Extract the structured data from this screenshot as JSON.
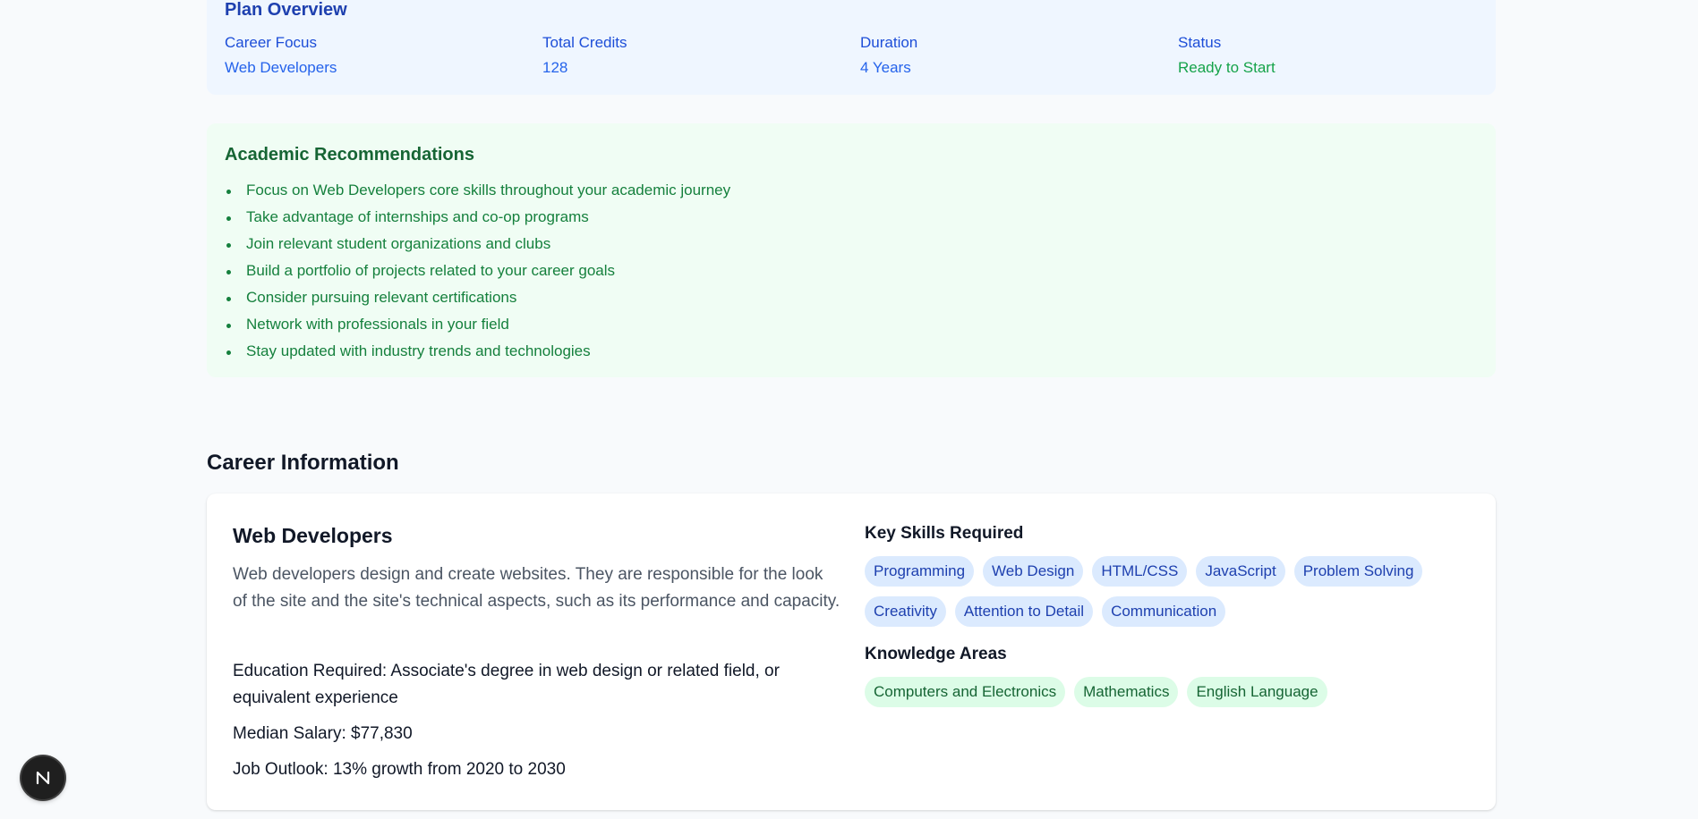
{
  "plan_overview": {
    "title": "Plan Overview",
    "career_focus": {
      "label": "Career Focus",
      "value": "Web Developers"
    },
    "total_credits": {
      "label": "Total Credits",
      "value": "128"
    },
    "duration": {
      "label": "Duration",
      "value": "4 Years"
    },
    "status": {
      "label": "Status",
      "value": "Ready to Start"
    }
  },
  "recommendations": {
    "title": "Academic Recommendations",
    "items": [
      "Focus on Web Developers core skills throughout your academic journey",
      "Take advantage of internships and co-op programs",
      "Join relevant student organizations and clubs",
      "Build a portfolio of projects related to your career goals",
      "Consider pursuing relevant certifications",
      "Network with professionals in your field",
      "Stay updated with industry trends and technologies"
    ]
  },
  "career": {
    "heading": "Career Information",
    "title": "Web Developers",
    "description": "Web developers design and create websites. They are responsible for the look of the site and the site's technical aspects, such as its performance and capacity.",
    "education": "Education Required: Associate's degree in web design or related field, or equivalent experience",
    "salary": "Median Salary: $77,830",
    "outlook": "Job Outlook: 13% growth from 2020 to 2030",
    "skills_heading": "Key Skills Required",
    "skills": [
      "Programming",
      "Web Design",
      "HTML/CSS",
      "JavaScript",
      "Problem Solving",
      "Creativity",
      "Attention to Detail",
      "Communication"
    ],
    "knowledge_heading": "Knowledge Areas",
    "knowledge": [
      "Computers and Electronics",
      "Mathematics",
      "English Language"
    ]
  },
  "badge": {
    "icon": "nextjs-logo-icon"
  },
  "colors": {
    "plan_bg": "#eff6ff",
    "plan_text": "#1d4ed8",
    "status_green": "#16a34a",
    "recs_bg": "#f0fdf4",
    "recs_text": "#15803d",
    "skill_tag_bg": "#dbeafe",
    "knowledge_tag_bg": "#dcfce7"
  }
}
